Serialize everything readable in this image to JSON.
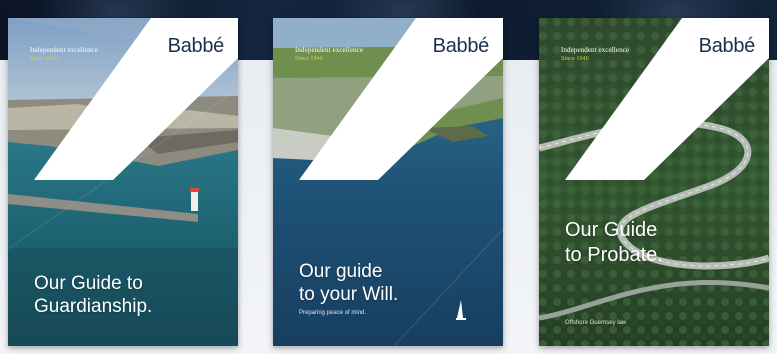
{
  "brochures": [
    {
      "eyebrow": "Independent excellence",
      "eyebrow_sub": "Since 1946",
      "logo": "Babbé",
      "title_line1": "Our Guide to",
      "title_line2": "Guardianship.",
      "tagline": ""
    },
    {
      "eyebrow": "Independent excellence",
      "eyebrow_sub": "Since 1946",
      "logo": "Babbé",
      "title_line1": "Our guide",
      "title_line2": "to your Will.",
      "tagline": "Preparing peace of mind."
    },
    {
      "eyebrow": "Independent excellence",
      "eyebrow_sub": "Since 1946",
      "logo": "Babbé",
      "title_line1": "Our Guide",
      "title_line2": "to Probate.",
      "tagline": "Offshore Guernsey law"
    }
  ]
}
